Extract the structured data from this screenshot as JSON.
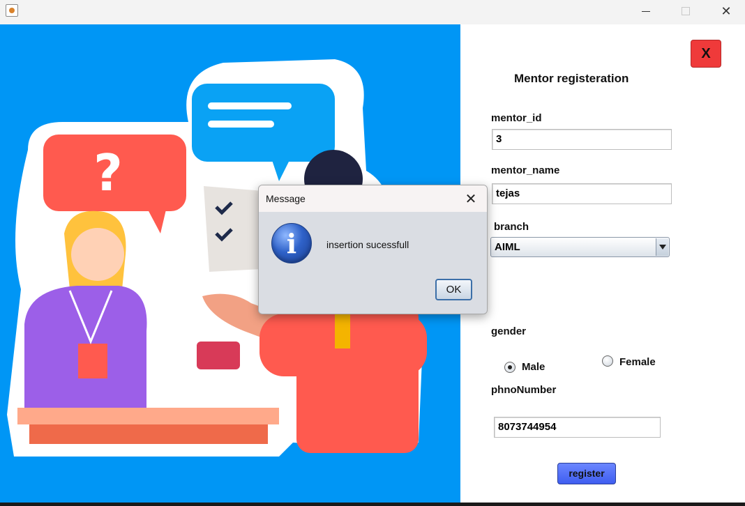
{
  "window": {
    "app_icon": "java-cup-icon"
  },
  "form": {
    "close_label": "X",
    "heading": "Mentor registeration",
    "mentor_id_label": "mentor_id",
    "mentor_id_value": "3",
    "mentor_name_label": "mentor_name",
    "mentor_name_value": "tejas",
    "branch_label": "branch",
    "branch_value": "AIML",
    "gender_label": "gender",
    "gender_options": [
      "Male",
      "Female"
    ],
    "gender_selected": "Male",
    "phone_label": "phnoNumber",
    "phone_value": "8073744954",
    "register_label": "register"
  },
  "dialog": {
    "title": "Message",
    "close_glyph": "✕",
    "icon": "info-icon",
    "icon_glyph": "i",
    "message": "insertion sucessfull",
    "ok_label": "OK"
  },
  "colors": {
    "illustration_bg": "#0096f5",
    "close_button": "#ef3a3a",
    "register_button": "#4f6cf6"
  }
}
